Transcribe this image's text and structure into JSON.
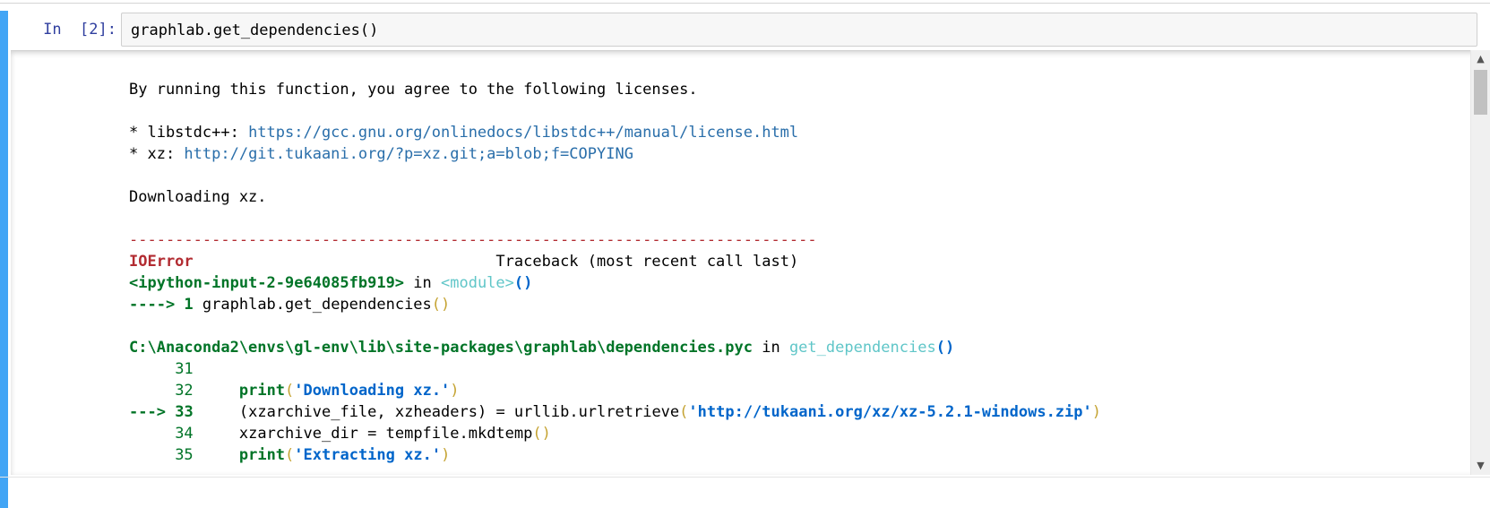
{
  "cell": {
    "prompt": "In  [2]:",
    "input_code": "graphlab.get_dependencies()"
  },
  "output": {
    "license_intro": "By running this function, you agree to the following licenses.",
    "licenses": [
      {
        "prefix": "* libstdc++: ",
        "url": "https://gcc.gnu.org/onlinedocs/libstdc++/manual/license.html"
      },
      {
        "prefix": "* xz: ",
        "url": "http://git.tukaani.org/?p=xz.git;a=blob;f=COPYING"
      }
    ],
    "downloading": "Downloading xz.",
    "separator": "---------------------------------------------------------------------------",
    "error": {
      "name": "IOError",
      "traceback_header": "Traceback (most recent call last)",
      "frame1": {
        "file": "<ipython-input-2-9e64085fb919>",
        "in_word": " in ",
        "func": "<module>",
        "parens": "()",
        "arrow": "----> ",
        "lineno": "1",
        "code": " graphlab.get_dependencies",
        "code_parens": "()"
      },
      "frame2": {
        "file": "C:\\Anaconda2\\envs\\gl-env\\lib\\site-packages\\graphlab\\dependencies.pyc",
        "in_word": " in ",
        "func": "get_dependencies",
        "parens": "()",
        "lines": [
          {
            "no": "31",
            "current": false,
            "arrow": "",
            "kw": "",
            "open": "",
            "str": "",
            "close": "",
            "rest": ""
          },
          {
            "no": "32",
            "current": false,
            "arrow": "",
            "kw": "print",
            "open": "(",
            "str": "'Downloading xz.'",
            "close": ")",
            "rest": ""
          },
          {
            "no": "33",
            "current": true,
            "arrow": "--->",
            "pre": " (xzarchive_file, xzheaders) = urllib.urlretrieve",
            "open": "(",
            "str": "'http://tukaani.org/xz/xz-5.2.1-windows.zip'",
            "close": ")"
          },
          {
            "no": "34",
            "current": false,
            "arrow": "",
            "plain": "xzarchive_dir = tempfile.mkdtemp",
            "p2": "()"
          },
          {
            "no": "35",
            "current": false,
            "arrow": "",
            "kw": "print",
            "open": "(",
            "str": "'Extracting xz.'",
            "close": ")",
            "rest": ""
          }
        ]
      }
    }
  },
  "scrollbar": {
    "up_icon": "▲",
    "down_icon": "▼"
  },
  "colors": {
    "cell_bar": "#42a5f5",
    "error_red": "#b22b31",
    "green": "#007427",
    "link_blue": "#296eaa",
    "string_blue": "#0065ca",
    "teal": "#60c6c8",
    "paren_gold": "#c5a332"
  }
}
